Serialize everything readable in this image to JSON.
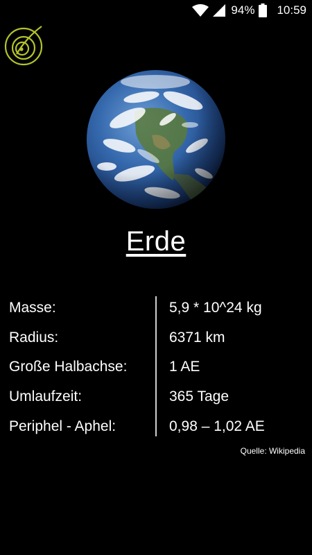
{
  "status_bar": {
    "battery_percent": "94%",
    "time": "10:59",
    "icons": [
      "wifi-icon",
      "signal-icon",
      "battery-icon"
    ]
  },
  "app": {
    "logo_icon": "orbit-logo-icon",
    "accent_color": "#b5c42a"
  },
  "planet": {
    "name": "Erde",
    "image_icon": "earth-globe-image"
  },
  "properties": [
    {
      "label": "Masse:",
      "value": "5,9 * 10^24 kg"
    },
    {
      "label": "Radius:",
      "value": "6371 km"
    },
    {
      "label": "Große Halbachse:",
      "value": "1 AE"
    },
    {
      "label": "Umlaufzeit:",
      "value": "365 Tage"
    },
    {
      "label": "Periphel - Aphel:",
      "value": "0,98 – 1,02 AE"
    }
  ],
  "source": "Quelle: Wikipedia"
}
